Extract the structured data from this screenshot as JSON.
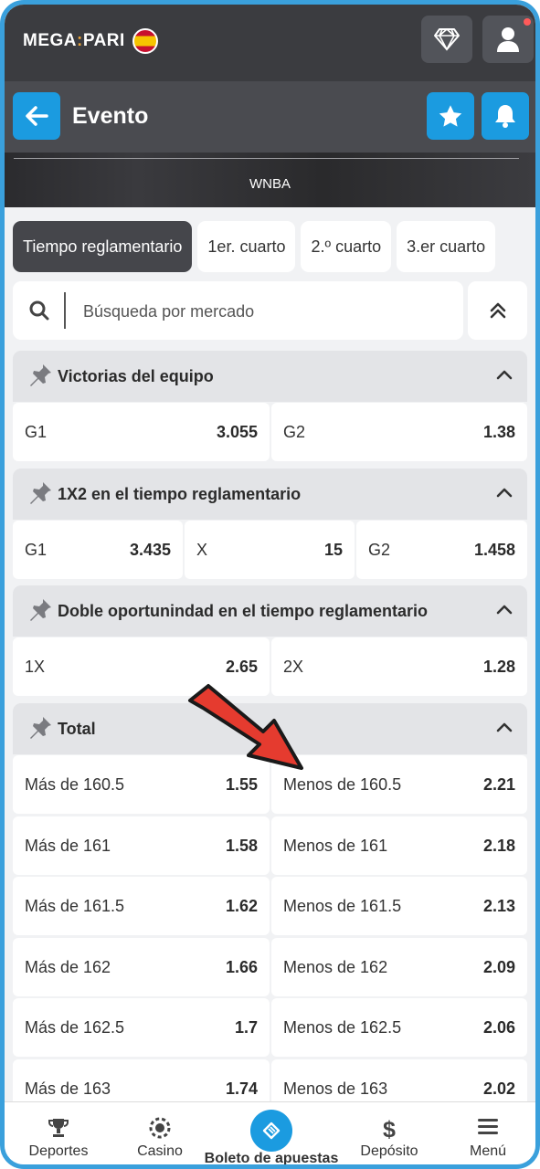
{
  "header": {
    "logo_left": "MEGA",
    "logo_sep": ":",
    "logo_right": "PARI",
    "icons": [
      "diamond-icon",
      "user-icon"
    ]
  },
  "event": {
    "title": "Evento",
    "league": "WNBA"
  },
  "tabs": [
    {
      "label": "Tiempo reglamentario",
      "active": true
    },
    {
      "label": "1er. cuarto",
      "active": false
    },
    {
      "label": "2.º cuarto",
      "active": false
    },
    {
      "label": "3.er cuarto",
      "active": false
    }
  ],
  "search": {
    "placeholder": "Búsqueda por mercado"
  },
  "markets": [
    {
      "title": "Victorias del equipo",
      "outcomes": [
        {
          "label": "G1",
          "odd": "3.055"
        },
        {
          "label": "G2",
          "odd": "1.38"
        }
      ]
    },
    {
      "title": "1X2 en el tiempo reglamentario",
      "outcomes": [
        {
          "label": "G1",
          "odd": "3.435"
        },
        {
          "label": "X",
          "odd": "15"
        },
        {
          "label": "G2",
          "odd": "1.458"
        }
      ]
    },
    {
      "title": "Doble oportunindad en el tiempo reglamentario",
      "outcomes": [
        {
          "label": "1X",
          "odd": "2.65"
        },
        {
          "label": "2X",
          "odd": "1.28"
        }
      ]
    },
    {
      "title": "Total",
      "outcomes": [
        {
          "label": "Más de 160.5",
          "odd": "1.55"
        },
        {
          "label": "Menos de 160.5",
          "odd": "2.21"
        },
        {
          "label": "Más de 161",
          "odd": "1.58"
        },
        {
          "label": "Menos de 161",
          "odd": "2.18"
        },
        {
          "label": "Más de 161.5",
          "odd": "1.62"
        },
        {
          "label": "Menos de 161.5",
          "odd": "2.13"
        },
        {
          "label": "Más de 162",
          "odd": "1.66"
        },
        {
          "label": "Menos de 162",
          "odd": "2.09"
        },
        {
          "label": "Más de 162.5",
          "odd": "1.7"
        },
        {
          "label": "Menos de 162.5",
          "odd": "2.06"
        },
        {
          "label": "Más de 163",
          "odd": "1.74"
        },
        {
          "label": "Menos de 163",
          "odd": "2.02"
        }
      ]
    }
  ],
  "bottom_nav": [
    {
      "label": "Deportes",
      "icon": "trophy-icon"
    },
    {
      "label": "Casino",
      "icon": "casino-chip-icon"
    },
    {
      "label": "Boleto de apuestas",
      "icon": "ticket-icon",
      "active": true
    },
    {
      "label": "Depósito",
      "icon": "dollar-icon"
    },
    {
      "label": "Menú",
      "icon": "menu-icon"
    }
  ],
  "colors": {
    "accent": "#1b9be0",
    "frame": "#3aa0dc",
    "header": "#3b3c40",
    "arrow": "#e53b2f"
  }
}
